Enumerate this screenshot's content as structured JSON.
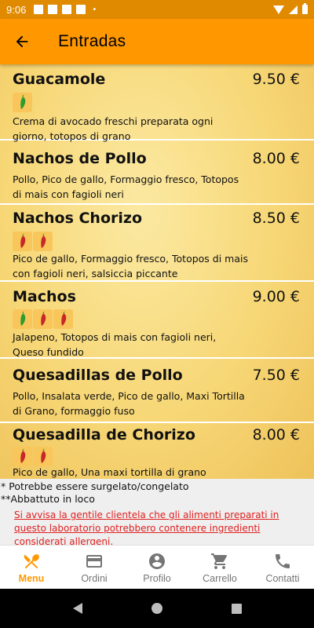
{
  "status_bar": {
    "time": "9:06",
    "dot": "•"
  },
  "app_bar": {
    "back_icon": "arrow-back-icon",
    "title": "Entradas"
  },
  "menu_items": [
    {
      "name": "Guacamole",
      "price": "9.50 €",
      "spice_level": 1,
      "description": "Crema di avocado freschi preparata ogni giorno, totopos di grano"
    },
    {
      "name": "Nachos de Pollo",
      "price": "8.00 €",
      "spice_level": 0,
      "description": "Pollo, Pico de gallo, Formaggio fresco, Totopos di mais con fagioli neri"
    },
    {
      "name": "Nachos Chorizo",
      "price": "8.50 €",
      "spice_level": 2,
      "description": "Pico de gallo, Formaggio fresco, Totopos di mais con fagioli neri, salsiccia piccante"
    },
    {
      "name": "Machos",
      "price": "9.00 €",
      "spice_level": 3,
      "description": "Jalapeno, Totopos di mais con fagioli neri, Queso fundido"
    },
    {
      "name": "Quesadillas de Pollo",
      "price": "7.50 €",
      "spice_level": 0,
      "description": "Pollo, Insalata verde, Pico de gallo, Maxi Tortilla di Grano, formaggio fuso"
    },
    {
      "name": "Quesadilla de Chorizo",
      "price": "8.00 €",
      "spice_level": 2,
      "description": "Pico de gallo, Una maxi tortilla di grano"
    }
  ],
  "notes": {
    "frozen": "* Potrebbe essere surgelato/congelato",
    "chilled": "**Abbattuto in loco",
    "allergen_warning": "Si avvisa la gentile clientela che gli alimenti preparati in questo laboratorio potrebbero contenere ingredienti considerati allergeni."
  },
  "bottom_nav": [
    {
      "label": "Menu",
      "icon": "fork-knife-icon",
      "active": true
    },
    {
      "label": "Ordini",
      "icon": "card-icon",
      "active": false
    },
    {
      "label": "Profilo",
      "icon": "account-icon",
      "active": false
    },
    {
      "label": "Carrello",
      "icon": "cart-icon",
      "active": false
    },
    {
      "label": "Contatti",
      "icon": "phone-icon",
      "active": false
    }
  ],
  "colors": {
    "app_bar": "#ff9800",
    "status_bar": "#e08a00",
    "warning": "#e02020",
    "active_nav": "#ff9800"
  }
}
